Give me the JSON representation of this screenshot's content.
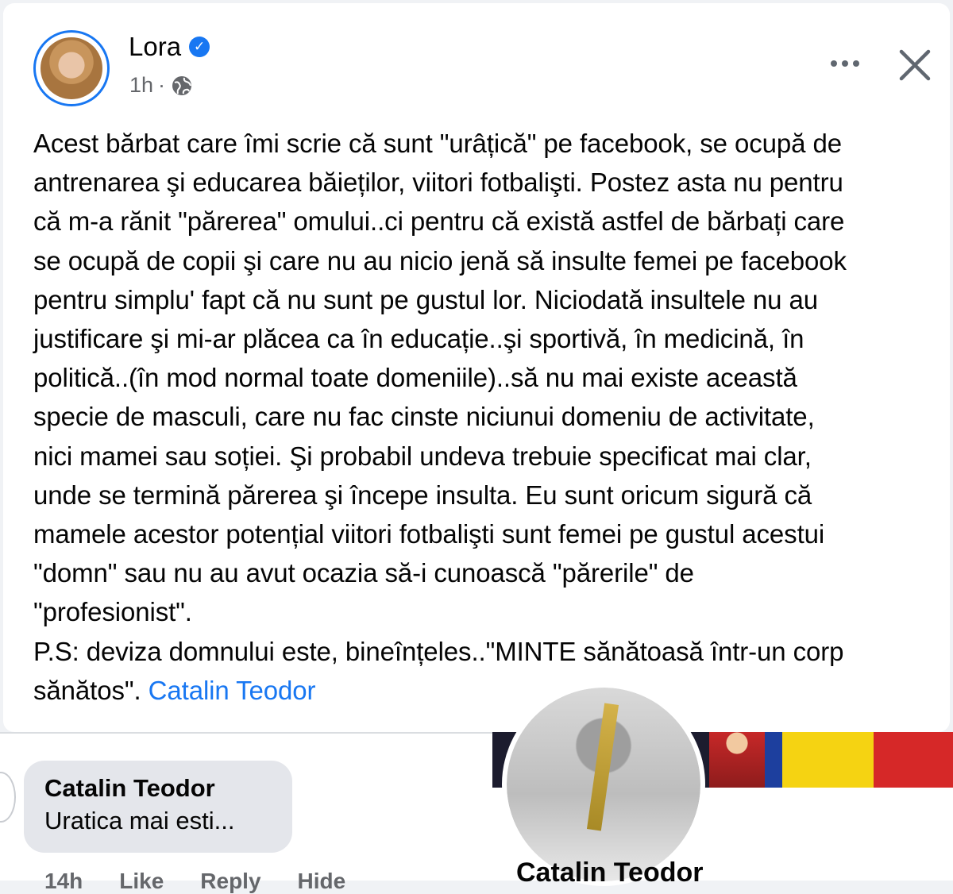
{
  "post": {
    "author": "Lora",
    "time": "1h",
    "separator": "·",
    "body": "Acest bărbat care îmi scrie că sunt \"urâțică\" pe facebook, se ocupă de\nantrenarea şi educarea băieților, viitori fotbalişti. Postez asta nu pentru\ncă m-a rănit \"părerea\" omului..ci pentru că există astfel de bărbați care\nse ocupă de copii şi care nu au nicio jenă să insulte femei pe facebook\npentru simplu' fapt că nu sunt pe gustul lor. Niciodată insultele nu au\njustificare şi mi-ar plăcea ca în educație..şi sportivă, în medicină, în\npolitică..(în mod normal toate domeniile)..să nu mai existe această\nspecie de masculi, care nu fac cinste niciunui domeniu de activitate,\nnici mamei sau soției. Şi probabil undeva trebuie specificat mai clar,\nunde se termină părerea şi începe insulta. Eu sunt oricum sigură că\nmamele acestor potențial viitori fotbalişti sunt femei pe gustul acestui\n\"domn\" sau nu au avut ocazia să-i cunoască \"părerile\" de\n\"profesionist\".\nP.S: deviza domnului este, bineînțeles..\"MINTE sănătoasă într-un corp\nsănătos\". ",
    "mention": "Catalin Teodor"
  },
  "screenshot": {
    "comment_name": "Catalin Teodor",
    "comment_text": "Uratica mai esti...",
    "actions": [
      "14h",
      "Like",
      "Reply",
      "Hide"
    ],
    "profile_name": "Catalin Teodor"
  },
  "icons": {
    "more": "more-horizontal-icon",
    "close": "close-icon",
    "privacy": "globe-icon",
    "verified": "verified-badge-icon"
  },
  "colors": {
    "accent": "#1877f2",
    "muted": "#65676b",
    "bubble": "#e4e6eb"
  }
}
